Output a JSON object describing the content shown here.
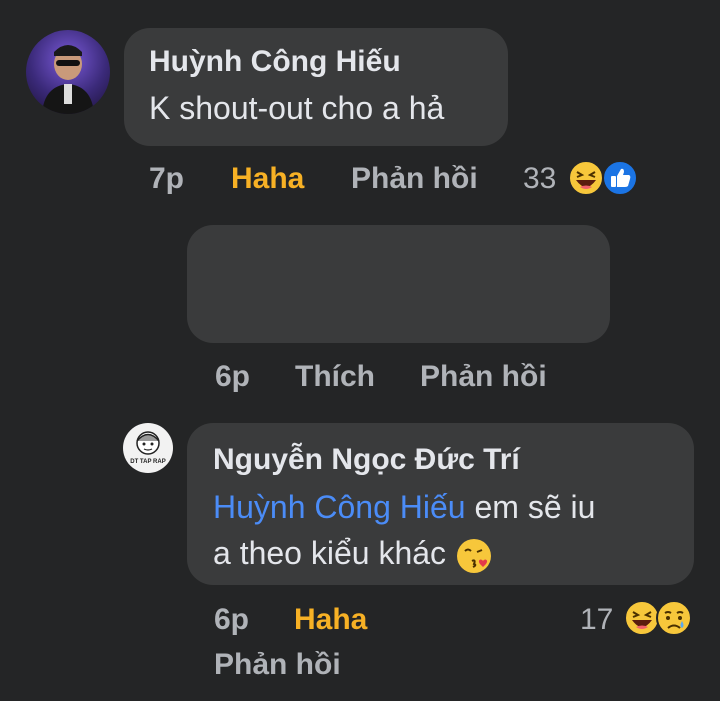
{
  "comments": [
    {
      "author": "Huỳnh Công Hiếu",
      "text": "K shout-out cho a hả",
      "time": "7p",
      "reaction_label": "Haha",
      "reply_label": "Phản hồi",
      "reaction_count": "33",
      "reaction_icons": [
        "haha-emoji-icon",
        "like-icon"
      ]
    },
    {
      "author": "",
      "text": "",
      "time": "6p",
      "like_label": "Thích",
      "reply_label": "Phản hồi"
    },
    {
      "author": "Nguyễn Ngọc Đức Trí",
      "mention": "Huỳnh Công Hiếu",
      "text_line1": "em sẽ iu",
      "text_line2": "a theo kiểu khác",
      "inline_emoji": "kissing-face-heart-icon",
      "time": "6p",
      "reaction_label": "Haha",
      "reply_label": "Phản hồi",
      "reaction_count": "17",
      "reaction_icons": [
        "haha-emoji-icon",
        "sad-emoji-icon"
      ],
      "avatar_text": "DT TAP RAP"
    }
  ],
  "colors": {
    "background": "#242526",
    "bubble": "#3a3b3c",
    "haha": "#f7b125",
    "mention": "#4b8cf7",
    "like_blue": "#1b74e4"
  }
}
